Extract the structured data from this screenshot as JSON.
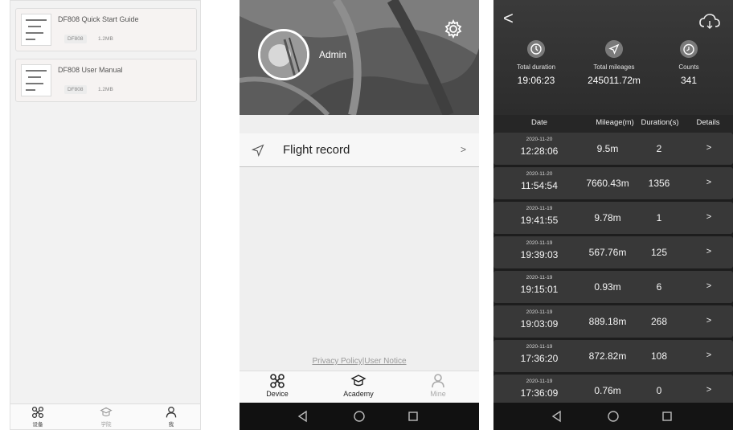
{
  "documents": {
    "items": [
      {
        "title": "DF808  Quick Start Guide",
        "model": "DF808",
        "size": "1.2MB"
      },
      {
        "title": "DF808  User Manual",
        "model": "DF808",
        "size": "1.2MB"
      }
    ],
    "nav": [
      {
        "label": "设备",
        "icon": "drone-icon"
      },
      {
        "label": "学院",
        "icon": "academy-icon"
      },
      {
        "label": "我",
        "icon": "person-icon"
      }
    ]
  },
  "mine": {
    "username": "Admin",
    "menu": {
      "flight_record": "Flight record",
      "chevron": ">"
    },
    "privacy": "Privacy Policy|User Notice",
    "nav": [
      {
        "label": "Device",
        "icon": "drone-icon"
      },
      {
        "label": "Academy",
        "icon": "academy-icon"
      },
      {
        "label": "Mine",
        "icon": "person-icon"
      }
    ]
  },
  "flight": {
    "back": "<",
    "stats": [
      {
        "label": "Total duration",
        "value": "19:06:23",
        "icon": "clock-icon"
      },
      {
        "label": "Total mileages",
        "value": "245011.72m",
        "icon": "send-icon"
      },
      {
        "label": "Counts",
        "value": "341",
        "icon": "counter-icon"
      }
    ],
    "headers": {
      "date": "Date",
      "mileage": "Mileage(m)",
      "duration": "Duration(s)",
      "details": "Details"
    },
    "rows": [
      {
        "date": "2020-11-20",
        "time": "12:28:06",
        "mileage": "9.5m",
        "duration": "2",
        "details": ">"
      },
      {
        "date": "2020-11-20",
        "time": "11:54:54",
        "mileage": "7660.43m",
        "duration": "1356",
        "details": ">"
      },
      {
        "date": "2020-11-19",
        "time": "19:41:55",
        "mileage": "9.78m",
        "duration": "1",
        "details": ">"
      },
      {
        "date": "2020-11-19",
        "time": "19:39:03",
        "mileage": "567.76m",
        "duration": "125",
        "details": ">"
      },
      {
        "date": "2020-11-19",
        "time": "19:15:01",
        "mileage": "0.93m",
        "duration": "6",
        "details": ">"
      },
      {
        "date": "2020-11-19",
        "time": "19:03:09",
        "mileage": "889.18m",
        "duration": "268",
        "details": ">"
      },
      {
        "date": "2020-11-19",
        "time": "17:36:20",
        "mileage": "872.82m",
        "duration": "108",
        "details": ">"
      },
      {
        "date": "2020-11-19",
        "time": "17:36:09",
        "mileage": "0.76m",
        "duration": "0",
        "details": ">"
      }
    ]
  },
  "system_nav": {
    "icons": [
      "back-triangle-icon",
      "home-circle-icon",
      "recents-square-icon"
    ]
  },
  "colors": {
    "accent_dark": "#1d1d1d",
    "row_bg": "#383838",
    "light_bg": "#efefef"
  }
}
